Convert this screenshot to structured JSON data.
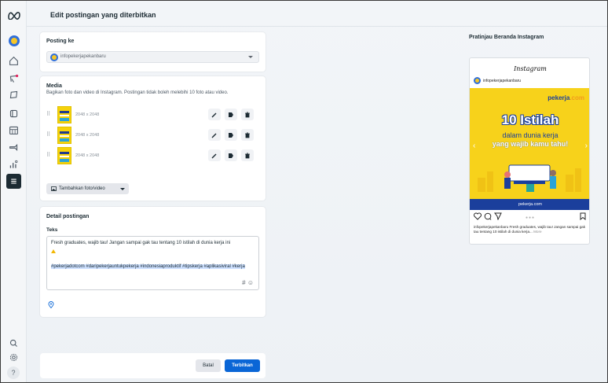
{
  "page": {
    "title": "Edit postingan yang diterbitkan"
  },
  "posting": {
    "title": "Posting ke",
    "account": "infopekerjapekanbaru"
  },
  "media": {
    "title": "Media",
    "subtitle": "Bagikan foto dan video di Instagram. Postingan tidak boleh melebihi 10 foto atau video.",
    "items": [
      {
        "dimensions": "2048 x 2048"
      },
      {
        "dimensions": "2048 x 2048"
      },
      {
        "dimensions": "2048 x 2048"
      }
    ],
    "add_label": "Tambahkan foto/video"
  },
  "details": {
    "title": "Detail postingan",
    "text_label": "Teks",
    "caption_line1": "Fresh graduates, wajib tau! Jangan sampai gak tau tentang 10 istilah di dunia kerja ini",
    "hashtags": "#pekerjadotcom #daripekerjauntukpekerja #indonesiaproduktif #tipskerja #aplikasiviral #kerja",
    "hash_icon": "#"
  },
  "footer": {
    "cancel_label": "Batal",
    "publish_label": "Terbitkan"
  },
  "preview": {
    "title": "Pratinjau Beranda Instagram",
    "ig_logo": "Instagram",
    "username": "infopekerjapekanbaru",
    "post_brand": "pekerja",
    "post_brand_suffix": ".com",
    "post_headline": "10 Istilah",
    "post_line1": "dalam dunia kerja",
    "post_line2": "yang wajib kamu tahu!",
    "post_footer": "pekerja.com",
    "caption": "infopekerjapekanbaru Fresh graduates, wajib tau! Jangan sampai gak tau tentang 10 istilah di dunia kerja...",
    "more": "More"
  },
  "colors": {
    "primary": "#0a66d6",
    "post_yellow": "#f7d21b",
    "post_blue": "#1b3f9c"
  }
}
